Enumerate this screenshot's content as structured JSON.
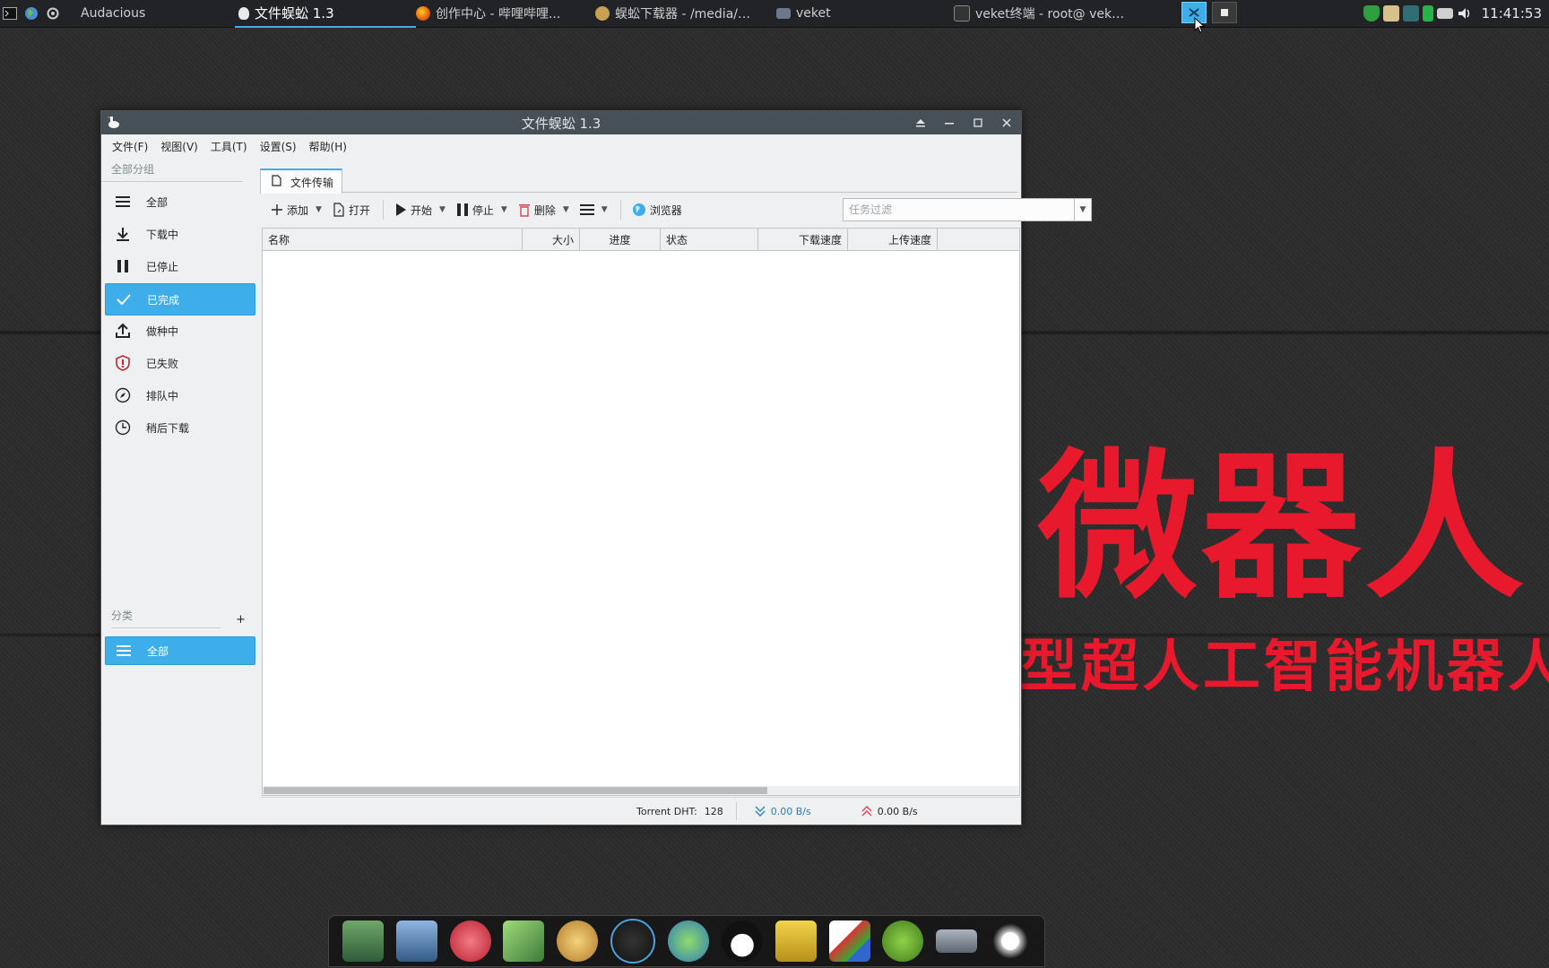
{
  "taskbar": {
    "tasks": [
      {
        "label": "Audacious"
      },
      {
        "label": "文件蜈蚣 1.3"
      },
      {
        "label": "创作中心 - 哔哩哔哩..."
      },
      {
        "label": "蜈蚣下载器 - /media/…"
      },
      {
        "label": "veket"
      },
      {
        "label": "veket终端 - root@ vek…"
      }
    ],
    "clock": "11:41:53"
  },
  "wallpaper": {
    "big": "微器人",
    "sub": "型超人工智能机器人"
  },
  "window": {
    "title": "文件蜈蚣 1.3",
    "menu": [
      "文件(F)",
      "视图(V)",
      "工具(T)",
      "设置(S)",
      "帮助(H)"
    ],
    "sidebar": {
      "header": "全部分组",
      "items": [
        {
          "label": "全部"
        },
        {
          "label": "下载中"
        },
        {
          "label": "已停止"
        },
        {
          "label": "已完成"
        },
        {
          "label": "做种中"
        },
        {
          "label": "已失败"
        },
        {
          "label": "排队中"
        },
        {
          "label": "稍后下载"
        }
      ],
      "category_header": "分类",
      "category_add": "+",
      "category_items": [
        {
          "label": "全部"
        }
      ]
    },
    "tab": {
      "label": "文件传输"
    },
    "toolbar": {
      "add": "添加",
      "open": "打开",
      "start": "开始",
      "stop": "停止",
      "delete": "删除",
      "browser": "浏览器",
      "filter_placeholder": "任务过滤"
    },
    "table": {
      "columns": [
        "名称",
        "大小",
        "进度",
        "状态",
        "下载速度",
        "上传速度"
      ],
      "rows": []
    },
    "status": {
      "dht_label": "Torrent DHT:",
      "dht_value": "128",
      "download_speed": "0.00 B/s",
      "upload_speed": "0.00 B/s"
    }
  }
}
